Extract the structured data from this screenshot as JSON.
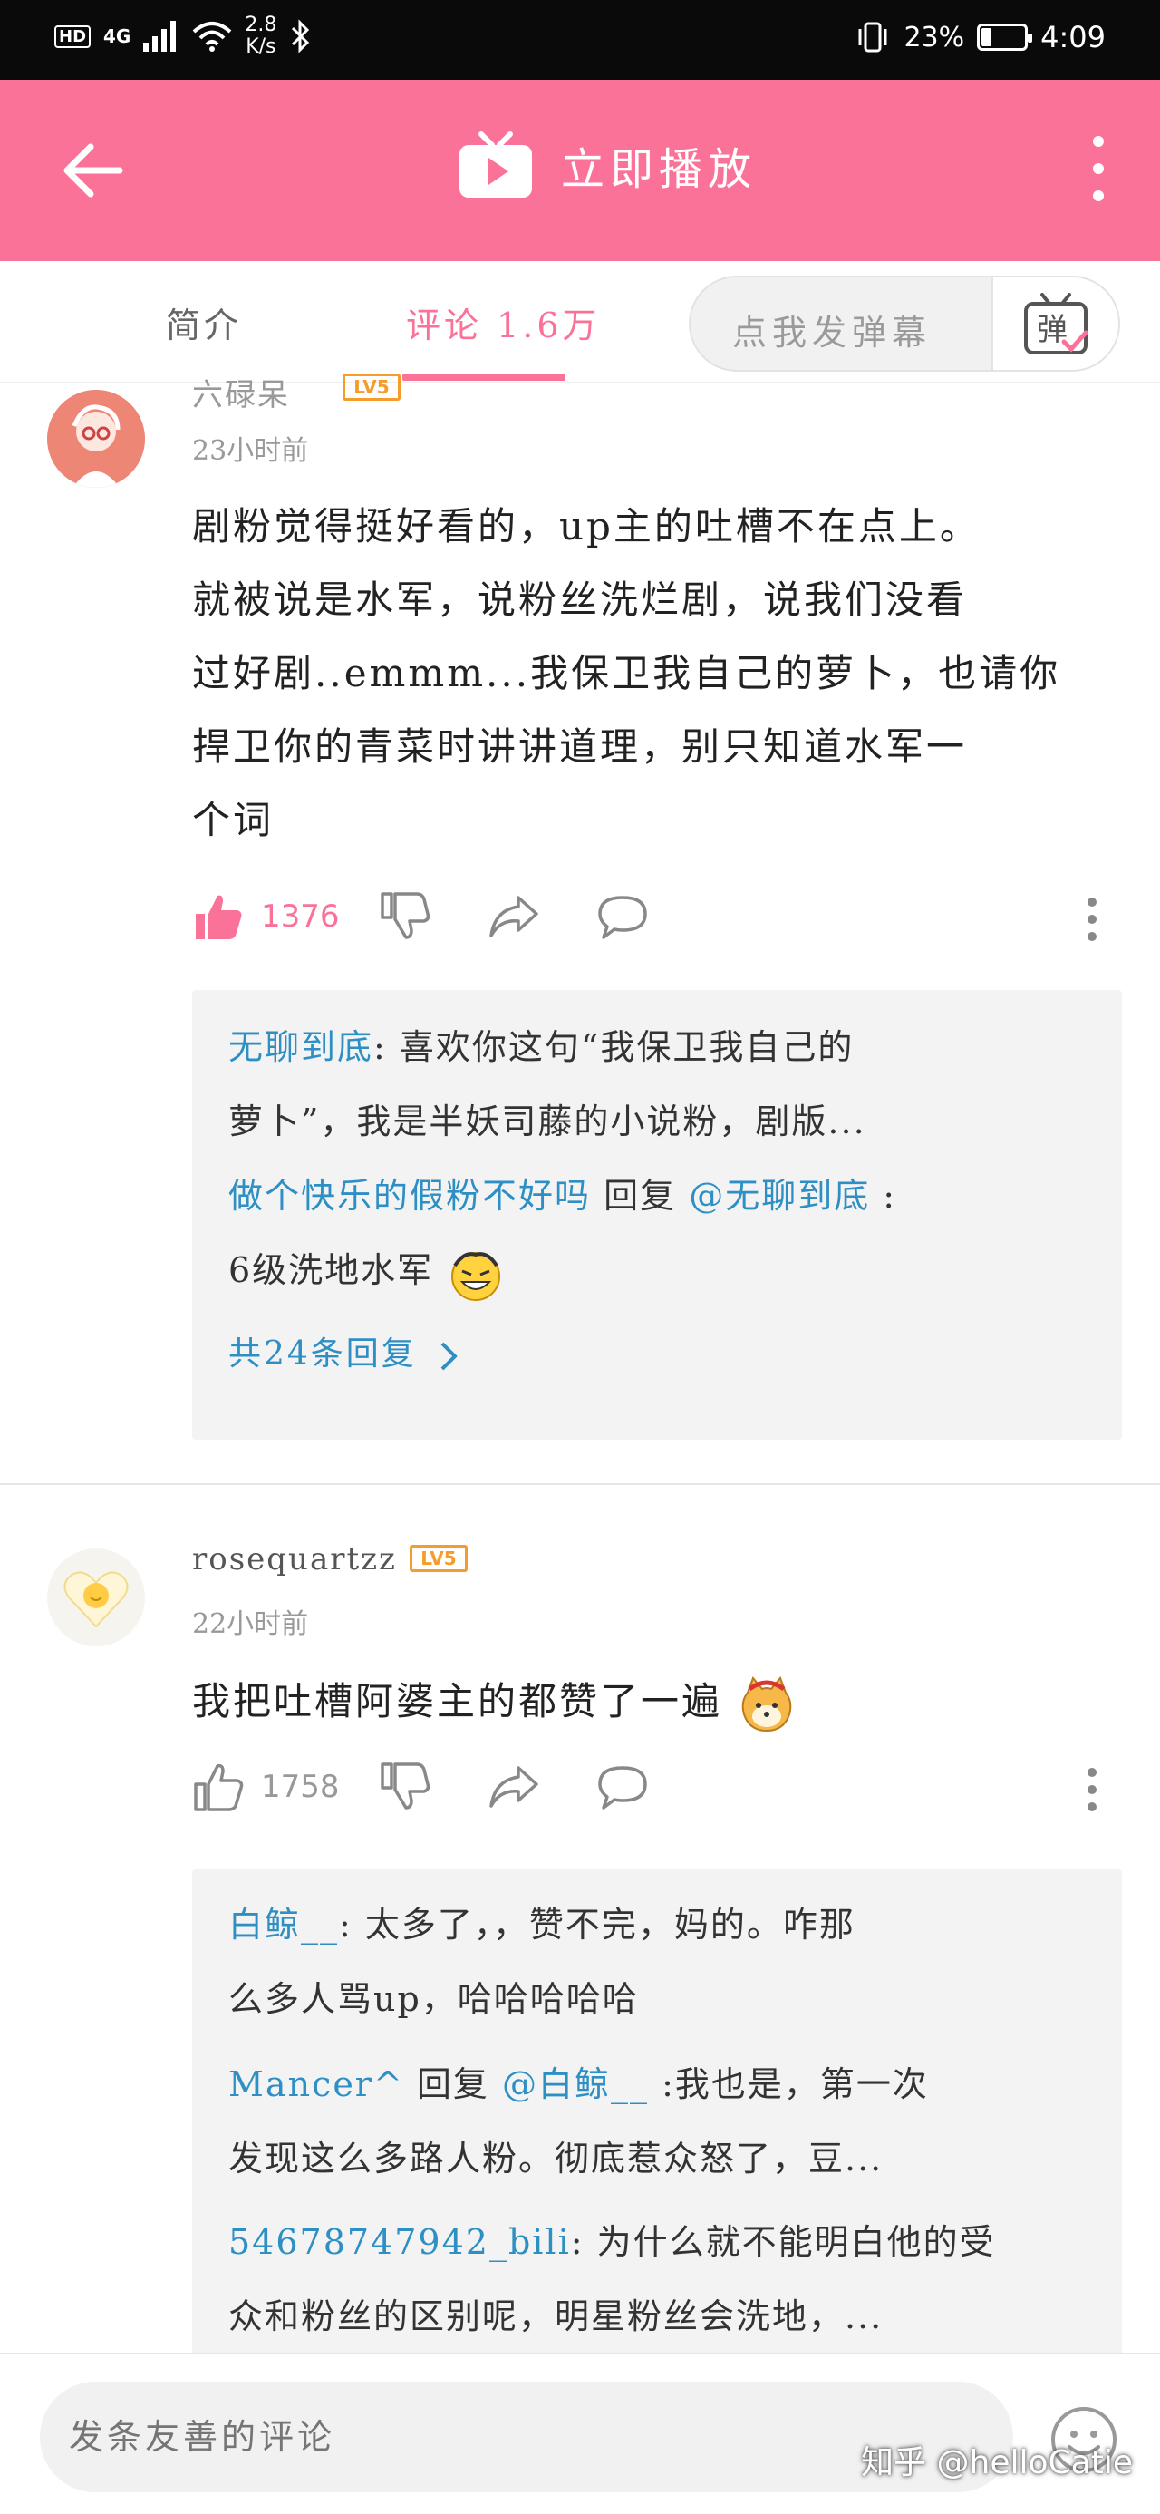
{
  "status_bar": {
    "hd": "HD",
    "network": "4G",
    "speed_line1": "2.8",
    "speed_line2": "K/s",
    "battery": "23%",
    "battery_level": 0.23,
    "time": "4:09"
  },
  "header": {
    "title": "立即播放"
  },
  "tabs": {
    "intro": "简介",
    "comments": "评论 1.6万"
  },
  "danmaku": {
    "placeholder": "点我发弹幕",
    "button_label": "弹"
  },
  "comments": [
    {
      "username": "六碌呆",
      "level": "LV5",
      "time": "23小时前",
      "text": "剧粉觉得挺好看的，up主的吐槽不在点上。就被说是水军，说粉丝洗烂剧，说我们没看过好剧..emmm...我保卫我自己的萝卜，也请你捍卫你的青菜时讲讲道理，别只知道水军一个词",
      "text_lines": [
        "剧粉觉得挺好看的，up主的吐槽不在点上。",
        "就被说是水军，说粉丝洗烂剧，说我们没看",
        "过好剧..emmm...我保卫我自己的萝卜，也请你",
        "捍卫你的青菜时讲讲道理，别只知道水军一",
        "个词"
      ],
      "likes": "1376",
      "liked": true,
      "replies": [
        {
          "name": "无聊到底",
          "text_line1": ": 喜欢你这句“我保卫我自己的",
          "text_line2": "萝卜”，我是半妖司藤的小说粉，剧版..."
        },
        {
          "name": "做个快乐的假粉不好吗",
          "reply_word": " 回复 ",
          "mention": "@无聊到底",
          "text_line1": " :",
          "text_line2": "6级洗地水军"
        }
      ],
      "more_replies": "共24条回复"
    },
    {
      "username": "rosequartzz",
      "level": "LV5",
      "time": "22小时前",
      "text": "我把吐槽阿婆主的都赞了一遍",
      "likes": "1758",
      "liked": false,
      "replies": [
        {
          "name": "白鲸__",
          "text_line1": ": 太多了，，赞不完，妈的。咋那",
          "text_line2": "么多人骂up，哈哈哈哈哈"
        },
        {
          "name": "Mancer^",
          "reply_word": "  回复 ",
          "mention": "@白鲸__",
          "text_line1": " :我也是，第一次",
          "text_line2": "发现这么多路人粉。彻底惹众怒了，豆..."
        },
        {
          "name": "54678747942_bili",
          "text_line1": ": 为什么就不能明白他的受",
          "text_line2": "众和粉丝的区别呢，明星粉丝会洗地，..."
        }
      ]
    }
  ],
  "bottom": {
    "input_placeholder": "发条友善的评论",
    "watermark": "知乎 @helloCatie"
  },
  "colors": {
    "brand_pink": "#fb7299",
    "link_blue": "#2d8fc4",
    "level_orange": "#f59c2a"
  }
}
